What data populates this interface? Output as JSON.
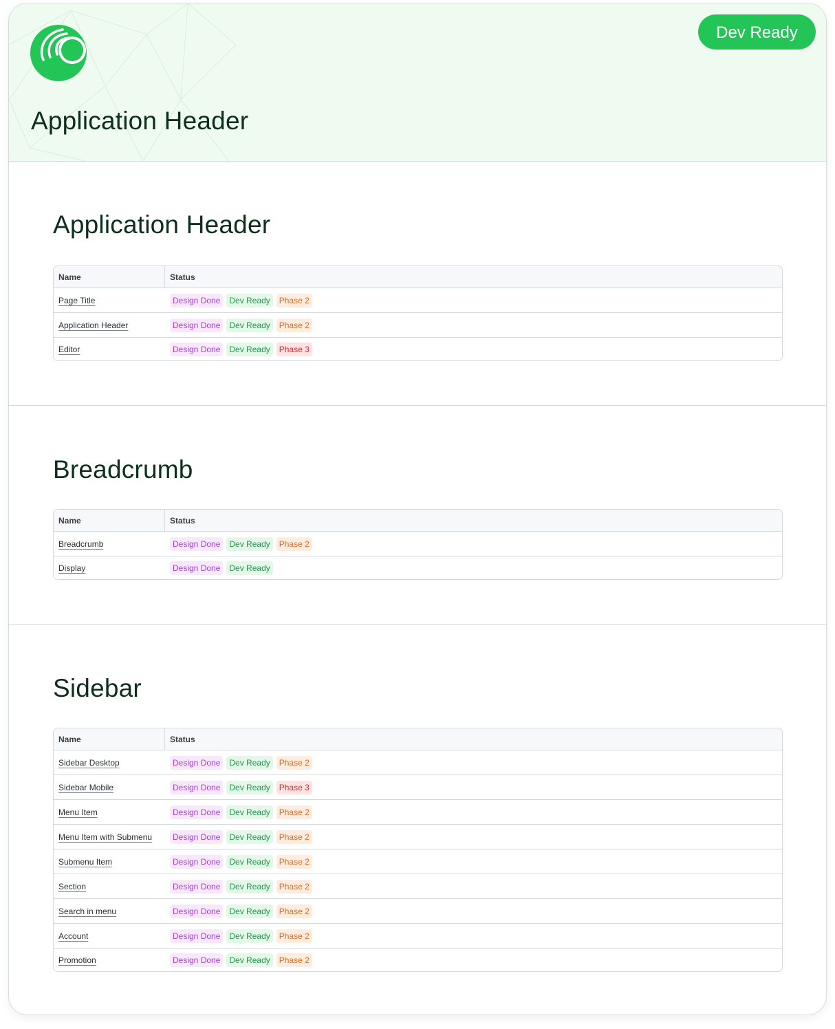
{
  "header": {
    "title": "Application Header",
    "status_label": "Dev Ready"
  },
  "colors": {
    "brand_green": "#24c557",
    "hero_background": "#effbf1",
    "heading_text": "#0e2f1c",
    "tag_design_text": "#a63fd0",
    "tag_dev_text": "#1f9a48",
    "tag_phase2_text": "#e26b12",
    "tag_phase3_text": "#d92a2a"
  },
  "icons": {
    "logo": "brand-logo-icon"
  },
  "table_headers": {
    "name": "Name",
    "status": "Status"
  },
  "sections": [
    {
      "title": "Application Header",
      "rows": [
        {
          "name": "Page Title",
          "tags": [
            {
              "label": "Design Done",
              "kind": "design"
            },
            {
              "label": "Dev Ready",
              "kind": "dev"
            },
            {
              "label": "Phase 2",
              "kind": "phase2"
            }
          ]
        },
        {
          "name": "Application Header",
          "tags": [
            {
              "label": "Design Done",
              "kind": "design"
            },
            {
              "label": "Dev Ready",
              "kind": "dev"
            },
            {
              "label": "Phase 2",
              "kind": "phase2"
            }
          ]
        },
        {
          "name": "Editor",
          "tags": [
            {
              "label": "Design Done",
              "kind": "design"
            },
            {
              "label": "Dev Ready",
              "kind": "dev"
            },
            {
              "label": "Phase 3",
              "kind": "phase3"
            }
          ]
        }
      ]
    },
    {
      "title": "Breadcrumb",
      "rows": [
        {
          "name": "Breadcrumb",
          "tags": [
            {
              "label": "Design Done",
              "kind": "design"
            },
            {
              "label": "Dev Ready",
              "kind": "dev"
            },
            {
              "label": "Phase 2",
              "kind": "phase2"
            }
          ]
        },
        {
          "name": "Display",
          "tags": [
            {
              "label": "Design Done",
              "kind": "design"
            },
            {
              "label": "Dev Ready",
              "kind": "dev"
            }
          ]
        }
      ]
    },
    {
      "title": "Sidebar",
      "rows": [
        {
          "name": "Sidebar Desktop",
          "tags": [
            {
              "label": "Design Done",
              "kind": "design"
            },
            {
              "label": "Dev Ready",
              "kind": "dev"
            },
            {
              "label": "Phase 2",
              "kind": "phase2"
            }
          ]
        },
        {
          "name": "Sidebar Mobile",
          "tags": [
            {
              "label": "Design Done",
              "kind": "design"
            },
            {
              "label": "Dev Ready",
              "kind": "dev"
            },
            {
              "label": "Phase 3",
              "kind": "phase3"
            }
          ]
        },
        {
          "name": "Menu Item",
          "tags": [
            {
              "label": "Design Done",
              "kind": "design"
            },
            {
              "label": "Dev Ready",
              "kind": "dev"
            },
            {
              "label": "Phase 2",
              "kind": "phase2"
            }
          ]
        },
        {
          "name": "Menu Item with Submenu",
          "tags": [
            {
              "label": "Design Done",
              "kind": "design"
            },
            {
              "label": "Dev Ready",
              "kind": "dev"
            },
            {
              "label": "Phase 2",
              "kind": "phase2"
            }
          ]
        },
        {
          "name": "Submenu Item",
          "tags": [
            {
              "label": "Design Done",
              "kind": "design"
            },
            {
              "label": "Dev Ready",
              "kind": "dev"
            },
            {
              "label": "Phase 2",
              "kind": "phase2"
            }
          ]
        },
        {
          "name": "Section",
          "tags": [
            {
              "label": "Design Done",
              "kind": "design"
            },
            {
              "label": "Dev Ready",
              "kind": "dev"
            },
            {
              "label": "Phase 2",
              "kind": "phase2"
            }
          ]
        },
        {
          "name": "Search in menu",
          "tags": [
            {
              "label": "Design Done",
              "kind": "design"
            },
            {
              "label": "Dev Ready",
              "kind": "dev"
            },
            {
              "label": "Phase 2",
              "kind": "phase2"
            }
          ]
        },
        {
          "name": "Account",
          "tags": [
            {
              "label": "Design Done",
              "kind": "design"
            },
            {
              "label": "Dev Ready",
              "kind": "dev"
            },
            {
              "label": "Phase 2",
              "kind": "phase2"
            }
          ]
        },
        {
          "name": "Promotion",
          "tags": [
            {
              "label": "Design Done",
              "kind": "design"
            },
            {
              "label": "Dev Ready",
              "kind": "dev"
            },
            {
              "label": "Phase 2",
              "kind": "phase2"
            }
          ]
        }
      ]
    }
  ]
}
